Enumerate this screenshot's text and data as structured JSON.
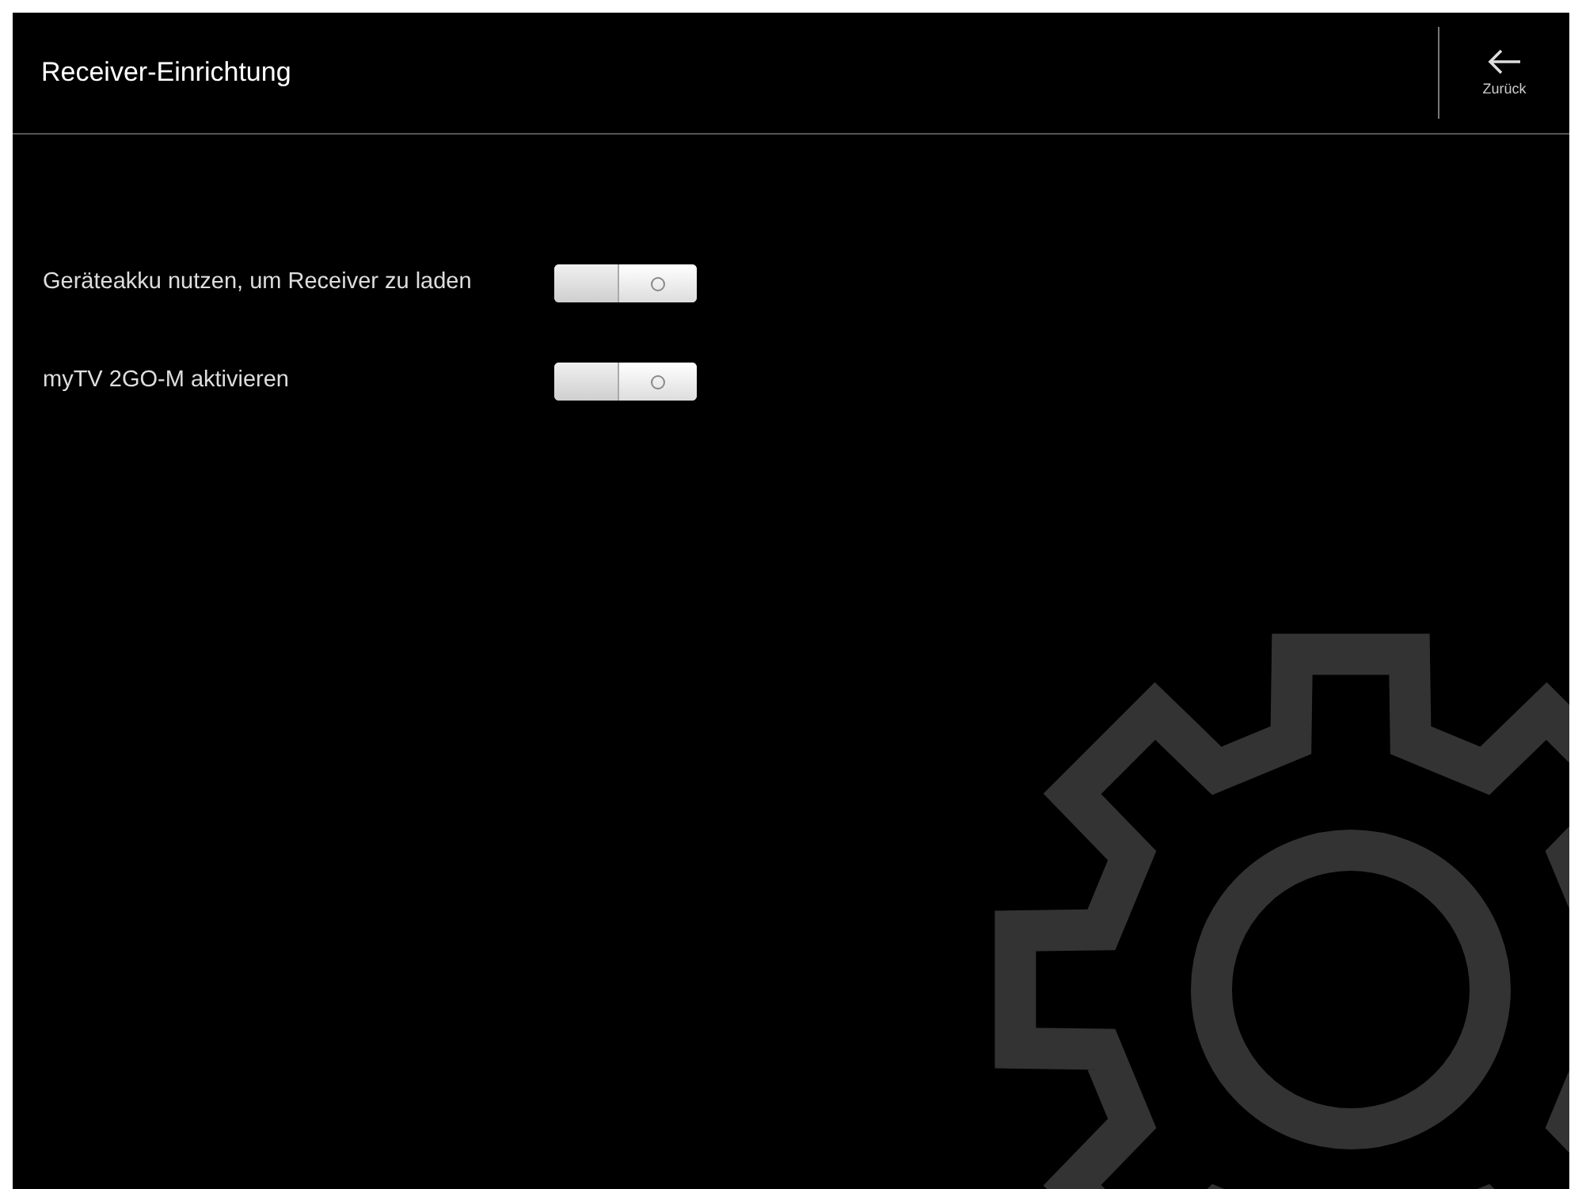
{
  "header": {
    "title": "Receiver-Einrichtung",
    "back_label": "Zurück"
  },
  "settings": [
    {
      "label": "Geräteakku nutzen, um Receiver zu laden",
      "on": false
    },
    {
      "label": "myTV 2GO-M aktivieren",
      "on": false
    }
  ]
}
